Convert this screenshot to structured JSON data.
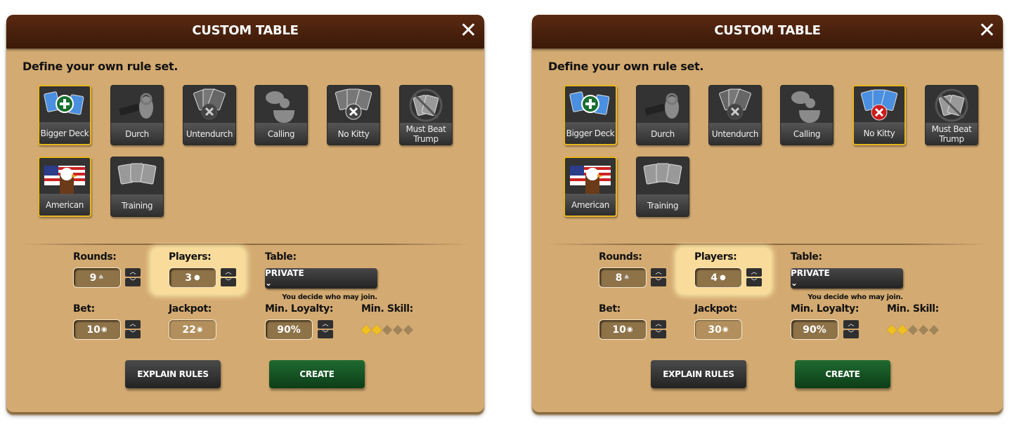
{
  "panels": [
    {
      "title": "CUSTOM TABLE",
      "close_icon": "close-x-icon",
      "subtitle": "Define your own rule set.",
      "rules": [
        {
          "label": "Bigger Deck",
          "icon": "bigger-deck-icon",
          "selected": true
        },
        {
          "label": "Durch",
          "icon": "ram-icon",
          "selected": false
        },
        {
          "label": "Untendurch",
          "icon": "cards-x-icon",
          "selected": false
        },
        {
          "label": "Calling",
          "icon": "speech-person-icon",
          "selected": false
        },
        {
          "label": "No Kitty",
          "icon": "no-kitty-icon",
          "selected": false
        },
        {
          "label": "Must Beat Trump",
          "icon": "no-trump-icon",
          "selected": false
        },
        {
          "label": "American",
          "icon": "eagle-flag-icon",
          "selected": true
        },
        {
          "label": "Training",
          "icon": "blank-cards-icon",
          "selected": false
        }
      ],
      "settings": {
        "rounds_label": "Rounds:",
        "rounds": "9",
        "players_label": "Players:",
        "players": "3",
        "table_label": "Table:",
        "table": "PRIVATE",
        "table_hint": "You decide who may join.",
        "bet_label": "Bet:",
        "bet": "10",
        "jackpot_label": "Jackpot:",
        "jackpot": "22",
        "loyalty_label": "Min. Loyalty:",
        "loyalty": "90%",
        "skill_label": "Min. Skill:",
        "skill_stars": 2,
        "skill_max": 5
      },
      "buttons": {
        "explain": "EXPLAIN RULES",
        "create": "CREATE"
      }
    },
    {
      "title": "CUSTOM TABLE",
      "close_icon": "close-x-icon",
      "subtitle": "Define your own rule set.",
      "rules": [
        {
          "label": "Bigger Deck",
          "icon": "bigger-deck-icon",
          "selected": true
        },
        {
          "label": "Durch",
          "icon": "ram-icon",
          "selected": false
        },
        {
          "label": "Untendurch",
          "icon": "cards-x-icon",
          "selected": false
        },
        {
          "label": "Calling",
          "icon": "speech-person-icon",
          "selected": false
        },
        {
          "label": "No Kitty",
          "icon": "no-kitty-icon",
          "selected": true
        },
        {
          "label": "Must Beat Trump",
          "icon": "no-trump-icon",
          "selected": false
        },
        {
          "label": "American",
          "icon": "eagle-flag-icon",
          "selected": true
        },
        {
          "label": "Training",
          "icon": "blank-cards-icon",
          "selected": false
        }
      ],
      "settings": {
        "rounds_label": "Rounds:",
        "rounds": "8",
        "players_label": "Players:",
        "players": "4",
        "table_label": "Table:",
        "table": "PRIVATE",
        "table_hint": "You decide who may join.",
        "bet_label": "Bet:",
        "bet": "10",
        "jackpot_label": "Jackpot:",
        "jackpot": "30",
        "loyalty_label": "Min. Loyalty:",
        "loyalty": "90%",
        "skill_label": "Min. Skill:",
        "skill_stars": 2,
        "skill_max": 5
      },
      "buttons": {
        "explain": "EXPLAIN RULES",
        "create": "CREATE"
      }
    }
  ],
  "colors": {
    "panel": "#d3aa71",
    "header": "#4a210d",
    "selected_border": "#e8b520",
    "create": "#1a5a28"
  }
}
